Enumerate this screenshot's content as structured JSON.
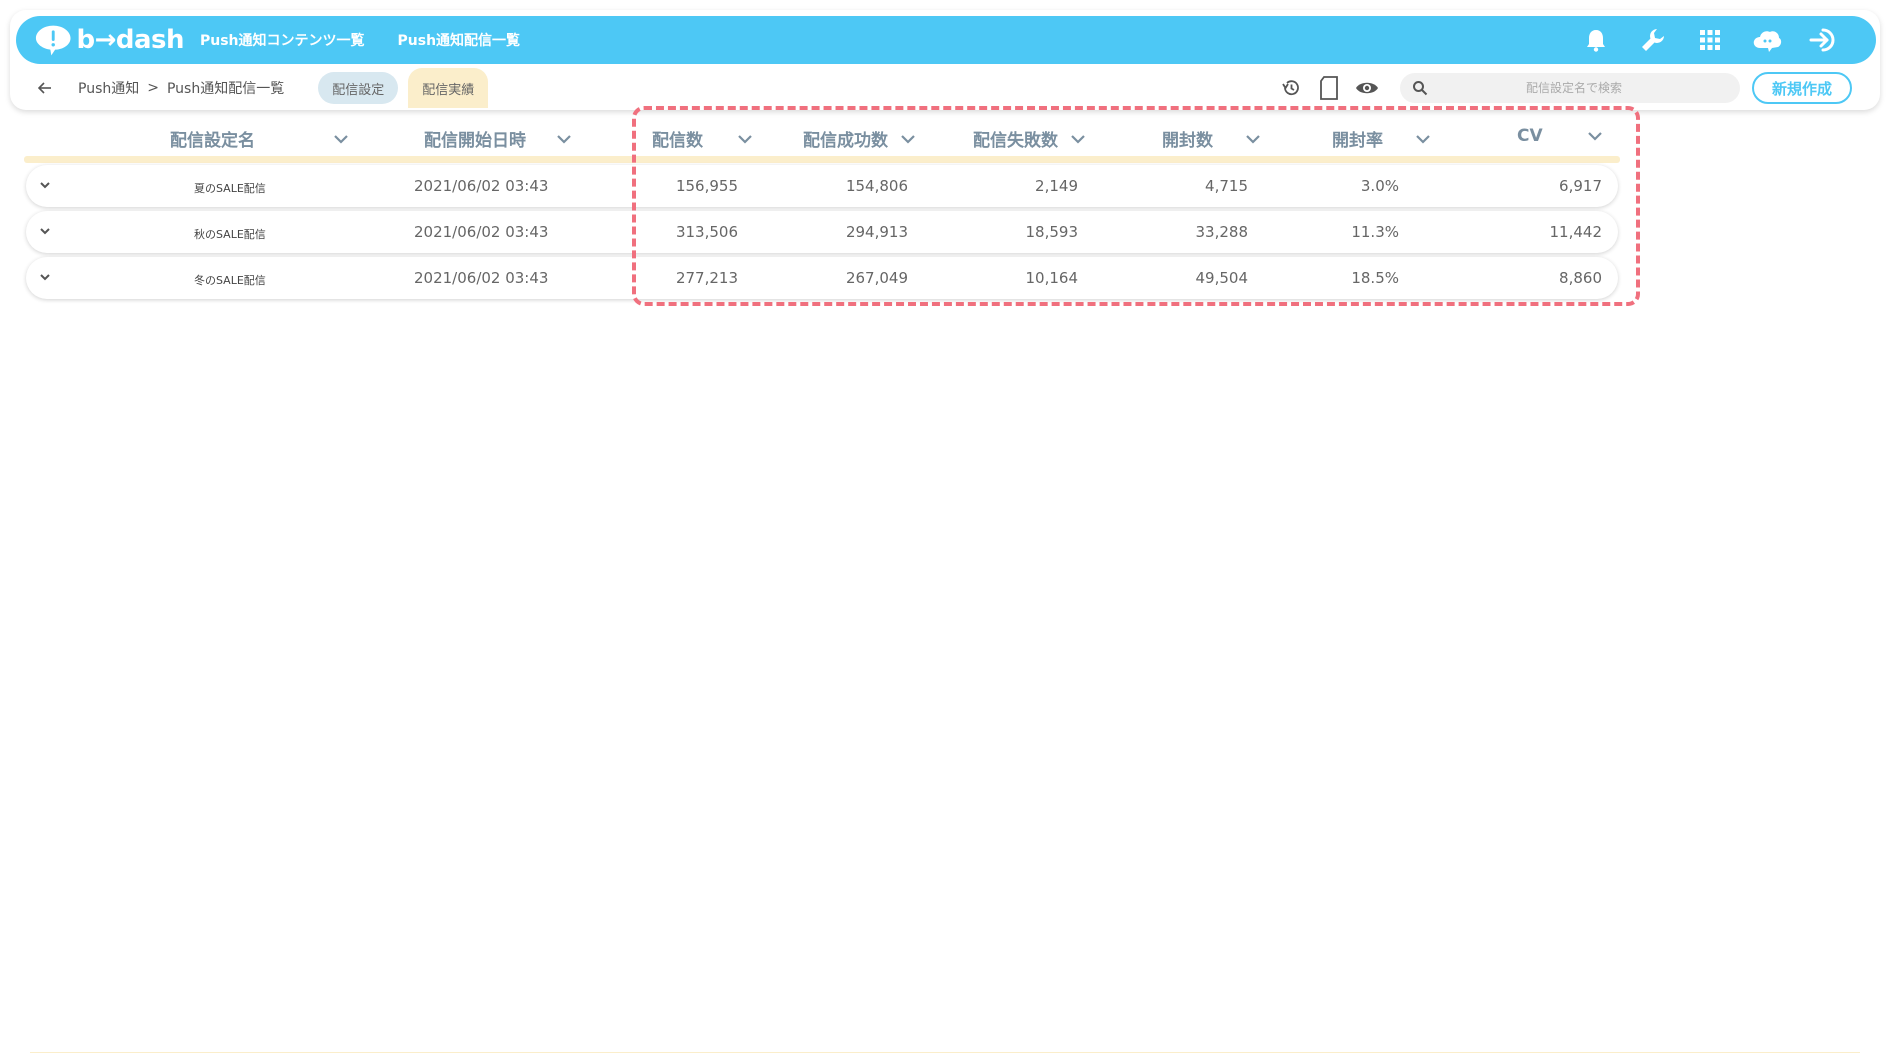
{
  "app": {
    "logo_text": "b→dash",
    "nav": [
      "Push通知コンテンツ一覧",
      "Push通知配信一覧"
    ],
    "icons": [
      "bell-icon",
      "wrench-icon",
      "grid-icon",
      "cloud-icon",
      "logout-icon"
    ]
  },
  "breadcrumb": {
    "root": "Push通知",
    "separator": ">",
    "current": "Push通知配信一覧"
  },
  "tabs": {
    "settings": "配信設定",
    "results": "配信実績"
  },
  "search": {
    "placeholder": "配信設定名で検索"
  },
  "actions": {
    "new_label": "新規作成"
  },
  "table": {
    "columns": [
      "配信設定名",
      "配信開始日時",
      "配信数",
      "配信成功数",
      "配信失敗数",
      "開封数",
      "開封率",
      "CV"
    ],
    "rows": [
      {
        "name": "夏のSALE配信",
        "start": "2021/06/02 03:43",
        "sent": "156,955",
        "success": "154,806",
        "failed": "2,149",
        "opened": "4,715",
        "open_rate": "3.0%",
        "cv": "6,917"
      },
      {
        "name": "秋のSALE配信",
        "start": "2021/06/02 03:43",
        "sent": "313,506",
        "success": "294,913",
        "failed": "18,593",
        "opened": "33,288",
        "open_rate": "11.3%",
        "cv": "11,442"
      },
      {
        "name": "冬のSALE配信",
        "start": "2021/06/02 03:43",
        "sent": "277,213",
        "success": "267,049",
        "failed": "10,164",
        "opened": "49,504",
        "open_rate": "18.5%",
        "cv": "8,860"
      }
    ]
  },
  "colors": {
    "brand": "#4dc8f5",
    "highlight": "#f0707e",
    "tab_active": "#fbeecb",
    "tab_inactive": "#d8e8f0"
  }
}
